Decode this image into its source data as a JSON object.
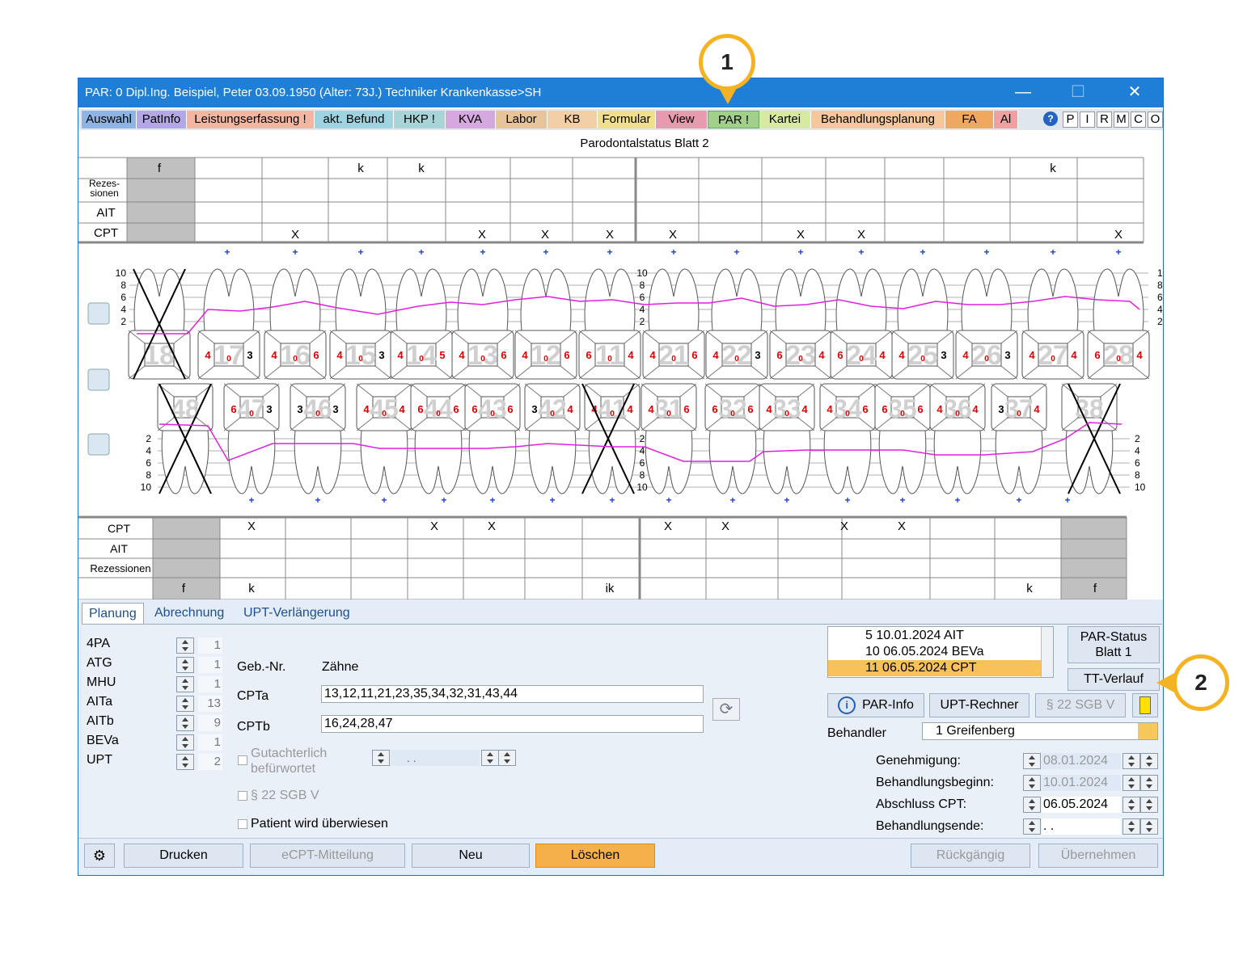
{
  "window": {
    "title": "PAR: 0  Dipl.Ing. Beispiel, Peter  03.09.1950 (Alter: 73J.)  Techniker Krankenkasse>SH",
    "minimize": "—",
    "maximize": "☐",
    "close": "✕"
  },
  "tabs": [
    {
      "label": "Auswahl",
      "color": "#8db4e2"
    },
    {
      "label": "PatInfo",
      "color": "#b4a7e6"
    },
    {
      "label": "Leistungserfassung !",
      "color": "#f4b6a0"
    },
    {
      "label": "akt. Befund",
      "color": "#9fd3e0"
    },
    {
      "label": "HKP !",
      "color": "#a8d4d8"
    },
    {
      "label": "KVA",
      "color": "#d6a8e0"
    },
    {
      "label": "Labor",
      "color": "#e8c49a"
    },
    {
      "label": "KB",
      "color": "#f2cfa6"
    },
    {
      "label": "Formular",
      "color": "#f0e08a"
    },
    {
      "label": "View",
      "color": "#e89aae"
    },
    {
      "label": "PAR !",
      "color": "#a3cf8d"
    },
    {
      "label": "Kartei",
      "color": "#d8eaa0"
    },
    {
      "label": "Behandlungsplanung",
      "color": "#f5c79a"
    },
    {
      "label": "FA",
      "color": "#f0a860"
    },
    {
      "label": "Al",
      "color": "#f0a0a0"
    }
  ],
  "right_buttons": [
    "P",
    "I",
    "R",
    "M",
    "C",
    "O"
  ],
  "help_icon": "?",
  "sheet_title": "Parodontalstatus Blatt 2",
  "upper_table": {
    "row_labels": [
      "Rezes-",
      "sionen",
      "AIT",
      "CPT"
    ],
    "first_col": "f",
    "k_marks": [
      "k",
      "k",
      "k"
    ],
    "x_mark": "X"
  },
  "upper_teeth": [
    "18",
    "17",
    "16",
    "15",
    "14",
    "13",
    "12",
    "11",
    "21",
    "22",
    "23",
    "24",
    "25",
    "26",
    "27",
    "28"
  ],
  "upper_values": [
    [
      "",
      "",
      ""
    ],
    [
      "4",
      "0",
      "3"
    ],
    [
      "4",
      "0",
      "6"
    ],
    [
      "4",
      "0",
      "3"
    ],
    [
      "4",
      "0",
      "5"
    ],
    [
      "4",
      "0",
      "6"
    ],
    [
      "4",
      "0",
      "6"
    ],
    [
      "6",
      "0",
      "4"
    ],
    [
      "4",
      "0",
      "6"
    ],
    [
      "4",
      "0",
      "3"
    ],
    [
      "6",
      "0",
      "4"
    ],
    [
      "6",
      "0",
      "4"
    ],
    [
      "4",
      "0",
      "3"
    ],
    [
      "4",
      "0",
      "3"
    ],
    [
      "4",
      "0",
      "4"
    ],
    [
      "6",
      "0",
      "4"
    ]
  ],
  "lower_teeth": [
    "48",
    "47",
    "46",
    "45",
    "44",
    "43",
    "42",
    "41",
    "31",
    "32",
    "33",
    "34",
    "35",
    "36",
    "37",
    "38"
  ],
  "lower_values": [
    [
      "",
      "",
      ""
    ],
    [
      "6",
      "0",
      "3"
    ],
    [
      "3",
      "0",
      "3"
    ],
    [
      "4",
      "0",
      "4"
    ],
    [
      "6",
      "0",
      "6"
    ],
    [
      "6",
      "0",
      "6"
    ],
    [
      "3",
      "0",
      "4"
    ],
    [
      "4",
      "0",
      "4"
    ],
    [
      "4",
      "0",
      "6"
    ],
    [
      "6",
      "0",
      "6"
    ],
    [
      "4",
      "0",
      "4"
    ],
    [
      "4",
      "0",
      "6"
    ],
    [
      "6",
      "0",
      "6"
    ],
    [
      "4",
      "0",
      "4"
    ],
    [
      "3",
      "0",
      "4"
    ],
    [
      "",
      "",
      ""
    ]
  ],
  "scale_upper": [
    "10",
    "8",
    "6",
    "4",
    "2"
  ],
  "scale_lower": [
    "2",
    "4",
    "6",
    "8",
    "10"
  ],
  "lower_table": {
    "row_labels": [
      "CPT",
      "AIT",
      "Rezessionen"
    ],
    "bottom_marks": [
      "f",
      "k",
      "ik",
      "k",
      "f"
    ],
    "x_mark": "X"
  },
  "subtabs": [
    "Planung",
    "Abrechnung",
    "UPT-Verlängerung"
  ],
  "counts": [
    {
      "label": "4PA",
      "value": "1"
    },
    {
      "label": "ATG",
      "value": "1"
    },
    {
      "label": "MHU",
      "value": "1"
    },
    {
      "label": "AITa",
      "value": "13"
    },
    {
      "label": "AITb",
      "value": "9"
    },
    {
      "label": "BEVa",
      "value": "1"
    },
    {
      "label": "UPT",
      "value": "2"
    }
  ],
  "form": {
    "col1_header": "Geb.-Nr.",
    "col2_header": "Zähne",
    "cpta_label": "CPTa",
    "cpta_value": "13,12,11,21,23,35,34,32,31,43,44",
    "cptb_label": "CPTb",
    "cptb_value": "16,24,28,47",
    "gutachter_line1": "Gutachterlich",
    "gutachter_line2": "befürwortet",
    "gutachter_date": ". .",
    "sgb_label": "§ 22 SGB V",
    "ueberwiesen_label": "Patient wird überwiesen"
  },
  "history": [
    {
      "text": "5  10.01.2024  AIT",
      "selected": false
    },
    {
      "text": "10  06.05.2024  BEVa",
      "selected": false
    },
    {
      "text": "11  06.05.2024  CPT",
      "selected": true
    }
  ],
  "buttons_right": {
    "par_status_1": "PAR-Status",
    "par_status_2": "Blatt 1",
    "tt_verlauf": "TT-Verlauf",
    "par_info": "PAR-Info",
    "upt_rechner": "UPT-Rechner",
    "sgb": "§ 22 SGB V"
  },
  "behandler": {
    "label": "Behandler",
    "value": "1 Greifenberg"
  },
  "dates": [
    {
      "label": "Genehmigung:",
      "value": "08.01.2024",
      "disabled": true
    },
    {
      "label": "Behandlungsbeginn:",
      "value": "10.01.2024",
      "disabled": true
    },
    {
      "label": "Abschluss CPT:",
      "value": "06.05.2024",
      "disabled": false
    },
    {
      "label": "Behandlungsende:",
      "value": ". .",
      "disabled": false
    }
  ],
  "footer": {
    "drucken": "Drucken",
    "ecpt": "eCPT-Mitteilung",
    "neu": "Neu",
    "loeschen": "Löschen",
    "rueckgaengig": "Rückgängig",
    "uebernehmen": "Übernehmen"
  },
  "callouts": [
    "1",
    "2"
  ],
  "colors": {
    "titlebar": "#1f7fd6",
    "accent": "#f5b324",
    "probing_line": "#e020e0",
    "selected_row": "#f8c15a"
  }
}
